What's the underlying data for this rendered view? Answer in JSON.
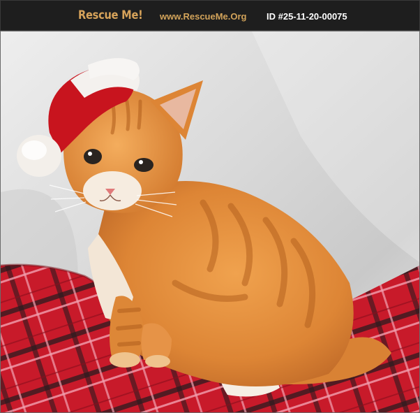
{
  "header": {
    "brand": "Rescue Me!",
    "site": "www.RescueMe.Org",
    "pet_id": "ID #25-11-20-00075"
  },
  "photo": {
    "subject": "orange-tabby-kitten",
    "colors": {
      "header_bg": "#1e1e1e",
      "brand": "#d7a35a",
      "fur": "#e0883a",
      "hat_red": "#c8141e",
      "blanket": "#c81a2a"
    }
  }
}
